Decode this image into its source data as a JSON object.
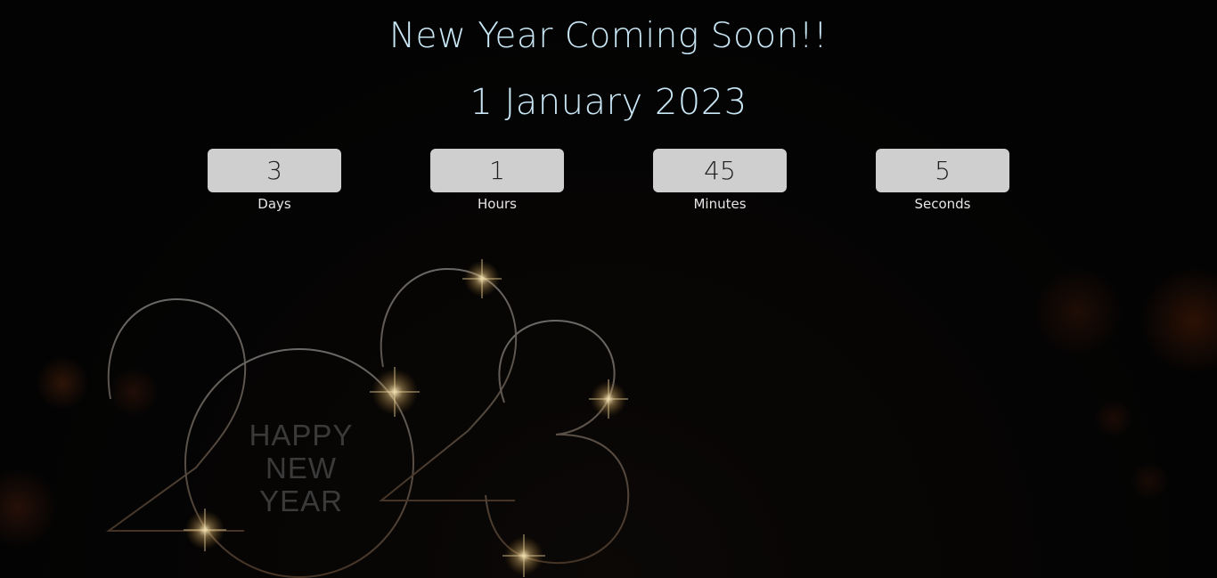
{
  "header": {
    "title": "New Year Coming Soon!!",
    "target_date": "1 January 2023"
  },
  "countdown": [
    {
      "value": "3",
      "label": "Days"
    },
    {
      "value": "1",
      "label": "Hours"
    },
    {
      "value": "45",
      "label": "Minutes"
    },
    {
      "value": "5",
      "label": "Seconds"
    }
  ],
  "artwork": {
    "greeting": [
      "HAPPY",
      "NEW",
      "YEAR"
    ],
    "year_outline_color": "#8a8580",
    "sparkle_color": "#f2d9a0"
  },
  "colors": {
    "background": "#050505",
    "headline": "#c8e6f5",
    "counter_box": "#cfcfcf",
    "counter_text": "#1e1e1e",
    "label_text": "#e6e6e6"
  }
}
